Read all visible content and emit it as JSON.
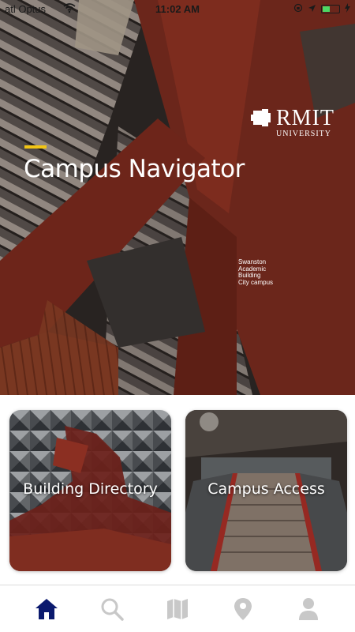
{
  "status_bar": {
    "carrier": "atl Optus",
    "time": "11:02 AM"
  },
  "hero": {
    "logo_text": "RMIT",
    "logo_subtext": "UNIVERSITY",
    "title": "Campus Navigator",
    "caption": "Swanston\nAcademic\nBuilding\nCity campus",
    "accent_color": "#f2c515"
  },
  "cards": [
    {
      "label": "Building Directory"
    },
    {
      "label": "Campus Access"
    }
  ],
  "tabbar": {
    "active_color": "#0b1a6e",
    "inactive_color": "#c8c8c8",
    "tabs": [
      {
        "icon": "home-icon",
        "active": true
      },
      {
        "icon": "search-icon",
        "active": false
      },
      {
        "icon": "map-icon",
        "active": false
      },
      {
        "icon": "location-pin-icon",
        "active": false
      },
      {
        "icon": "profile-icon",
        "active": false
      }
    ]
  }
}
